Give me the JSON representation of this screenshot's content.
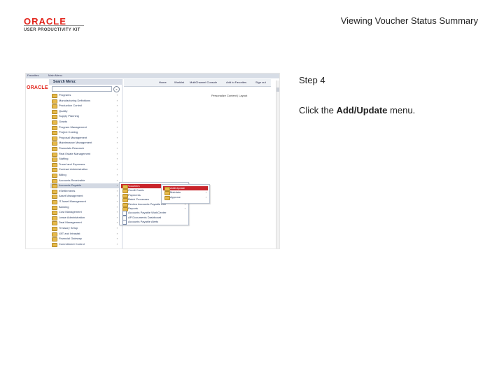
{
  "branding": {
    "logo_word": "ORACLE",
    "logo_sub": "USER PRODUCTIVITY KIT",
    "logo_color": "#e2231a"
  },
  "document": {
    "title": "Viewing Voucher Status Summary"
  },
  "instruction": {
    "step": "Step 4",
    "prefix": "Click the ",
    "target": "Add/Update",
    "suffix": " menu."
  },
  "screenshot": {
    "top_tabs": [
      "Favorites",
      "Main Menu"
    ],
    "logo_mini": "ORACLE",
    "nav_links": [
      "Home",
      "Worklist",
      "MultiChannel Console",
      "Add to Favorites",
      "Sign out"
    ],
    "personalize": "Personalize Content | Layout",
    "menu": {
      "title": "Search Menu:",
      "items": [
        "Programs",
        "Manufacturing Definitions",
        "Production Control",
        "Quality",
        "Supply Planning",
        "Grants",
        "Program Management",
        "Project Costing",
        "Proposal Management",
        "Maintenance Management",
        "Financials Research",
        "Real Estate Management",
        "Staffing",
        "Travel and Expenses",
        "Contract Administration",
        "Billing",
        "Accounts Receivable",
        "Accounts Payable",
        "eSettlements",
        "Asset Management",
        "IT Asset Management",
        "Banking",
        "Cost Management",
        "Lease Administration",
        "Deal Management",
        "Treasury Setup",
        "VAT and Intrastat",
        "Financial Gateway",
        "Commitment Control"
      ],
      "active_index": 17
    },
    "submenu1": {
      "items": [
        "Vouchers",
        "Credit Cards",
        "Payments",
        "Batch Processes",
        "Review Accounts Payable Info",
        "Reports",
        "Accounts Payable WorkCenter",
        "AP Documents Dashboard",
        "Accounts Payable Alerts"
      ],
      "active_index": 0
    },
    "submenu2": {
      "items": [
        "Add/Update",
        "Maintain",
        "Approve"
      ],
      "active_index": 0
    },
    "active_color": "#c9242b"
  }
}
